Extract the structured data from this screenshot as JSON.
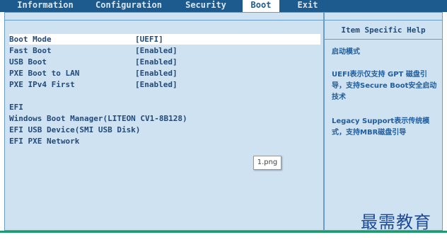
{
  "tabs": [
    "Information",
    "Configuration",
    "Security",
    "Boot",
    "Exit"
  ],
  "active_tab": "Boot",
  "settings": [
    {
      "label": "Boot Mode",
      "value": "[UEFI]"
    },
    {
      "label": "Fast Boot",
      "value": "[Enabled]"
    },
    {
      "label": "USB Boot",
      "value": "[Enabled]"
    },
    {
      "label": "PXE Boot to LAN",
      "value": "[Enabled]"
    },
    {
      "label": "PXE IPv4 First",
      "value": "[Enabled]"
    }
  ],
  "boot_section": {
    "header": "EFI",
    "items": [
      "Windows Boot Manager(LITEON CV1-8B128)",
      "EFI USB Device(SMI USB Disk)",
      "EFI PXE Network"
    ]
  },
  "side_panel": {
    "title": "Item Specific Help",
    "help_lines": [
      "启动模式",
      "UEFI表示仅支持 GPT 磁盘引导，支持Secure Boot安全启动技术",
      "Legacy Support表示传统模式，支持MBR磁盘引导"
    ]
  },
  "tooltip": "1.png",
  "watermark": "最需教育"
}
